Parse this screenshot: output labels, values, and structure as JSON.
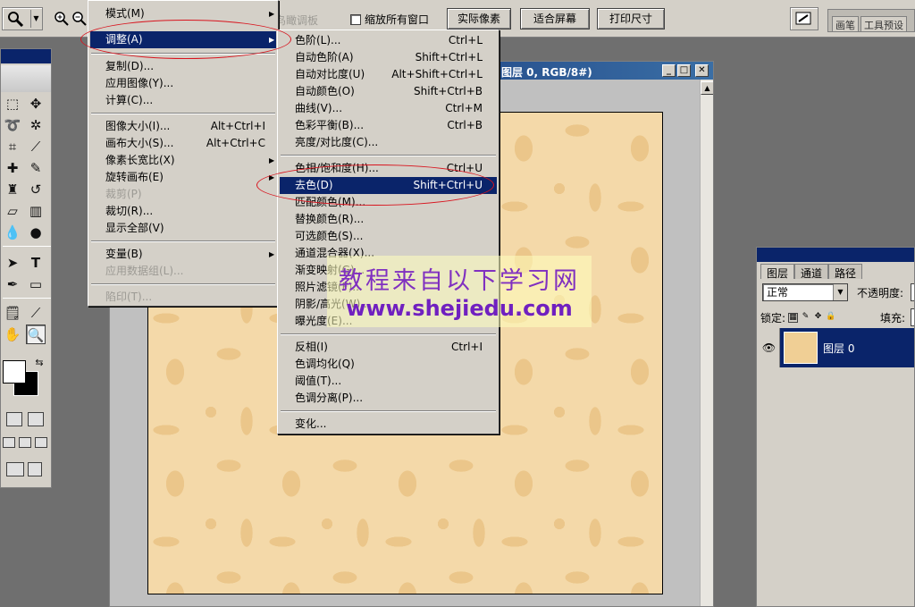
{
  "options_bar": {
    "grey_label": "鸟瞰调板",
    "resize_windows_label": "缩放所有窗口",
    "buttons": [
      "实际像素",
      "适合屏幕",
      "打印尺寸"
    ],
    "palette_well_tabs": [
      "画笔",
      "工具预设"
    ]
  },
  "document": {
    "title": "图层 0, RGB/8#)"
  },
  "image_menu": {
    "items": [
      {
        "label": "模式(M)",
        "shortcut": "",
        "submenu": true,
        "state": "normal"
      },
      {
        "label": "调整(A)",
        "shortcut": "",
        "submenu": true,
        "state": "selected"
      },
      {
        "label": "复制(D)...",
        "shortcut": "",
        "submenu": false,
        "state": "normal"
      },
      {
        "label": "应用图像(Y)...",
        "shortcut": "",
        "submenu": false,
        "state": "normal"
      },
      {
        "label": "计算(C)...",
        "shortcut": "",
        "submenu": false,
        "state": "normal"
      },
      {
        "label": "图像大小(I)...",
        "shortcut": "Alt+Ctrl+I",
        "submenu": false,
        "state": "normal"
      },
      {
        "label": "画布大小(S)...",
        "shortcut": "Alt+Ctrl+C",
        "submenu": false,
        "state": "normal"
      },
      {
        "label": "像素长宽比(X)",
        "shortcut": "",
        "submenu": true,
        "state": "normal"
      },
      {
        "label": "旋转画布(E)",
        "shortcut": "",
        "submenu": true,
        "state": "normal"
      },
      {
        "label": "裁剪(P)",
        "shortcut": "",
        "submenu": false,
        "state": "disabled"
      },
      {
        "label": "裁切(R)...",
        "shortcut": "",
        "submenu": false,
        "state": "normal"
      },
      {
        "label": "显示全部(V)",
        "shortcut": "",
        "submenu": false,
        "state": "normal"
      },
      {
        "label": "变量(B)",
        "shortcut": "",
        "submenu": true,
        "state": "normal"
      },
      {
        "label": "应用数据组(L)...",
        "shortcut": "",
        "submenu": false,
        "state": "disabled"
      },
      {
        "label": "陷印(T)...",
        "shortcut": "",
        "submenu": false,
        "state": "disabled"
      }
    ]
  },
  "adjust_menu": {
    "items": [
      {
        "label": "色阶(L)...",
        "shortcut": "Ctrl+L",
        "state": "normal"
      },
      {
        "label": "自动色阶(A)",
        "shortcut": "Shift+Ctrl+L",
        "state": "normal"
      },
      {
        "label": "自动对比度(U)",
        "shortcut": "Alt+Shift+Ctrl+L",
        "state": "normal"
      },
      {
        "label": "自动颜色(O)",
        "shortcut": "Shift+Ctrl+B",
        "state": "normal"
      },
      {
        "label": "曲线(V)...",
        "shortcut": "Ctrl+M",
        "state": "normal"
      },
      {
        "label": "色彩平衡(B)...",
        "shortcut": "Ctrl+B",
        "state": "normal"
      },
      {
        "label": "亮度/对比度(C)...",
        "shortcut": "",
        "state": "normal"
      },
      {
        "label": "色相/饱和度(H)...",
        "shortcut": "Ctrl+U",
        "state": "normal"
      },
      {
        "label": "去色(D)",
        "shortcut": "Shift+Ctrl+U",
        "state": "selected"
      },
      {
        "label": "匹配颜色(M)...",
        "shortcut": "",
        "state": "normal"
      },
      {
        "label": "替换颜色(R)...",
        "shortcut": "",
        "state": "normal"
      },
      {
        "label": "可选颜色(S)...",
        "shortcut": "",
        "state": "normal"
      },
      {
        "label": "通道混合器(X)...",
        "shortcut": "",
        "state": "normal"
      },
      {
        "label": "渐变映射(G)...",
        "shortcut": "",
        "state": "normal"
      },
      {
        "label": "照片滤镜(F)...",
        "shortcut": "",
        "state": "normal"
      },
      {
        "label": "阴影/高光(W)...",
        "shortcut": "",
        "state": "normal"
      },
      {
        "label": "曝光度(E)...",
        "shortcut": "",
        "state": "normal"
      },
      {
        "label": "反相(I)",
        "shortcut": "Ctrl+I",
        "state": "normal"
      },
      {
        "label": "色调均化(Q)",
        "shortcut": "",
        "state": "normal"
      },
      {
        "label": "阈值(T)...",
        "shortcut": "",
        "state": "normal"
      },
      {
        "label": "色调分离(P)...",
        "shortcut": "",
        "state": "normal"
      },
      {
        "label": "变化...",
        "shortcut": "",
        "state": "normal"
      }
    ]
  },
  "layers_panel": {
    "tabs": [
      "图层",
      "通道",
      "路径"
    ],
    "blend_mode": "正常",
    "opacity_label": "不透明度:",
    "lock_label": "锁定:",
    "fill_label": "填充:",
    "layer_name": "图层 0"
  },
  "watermark": {
    "line1": "教程来自以下学习网",
    "line2": "www.shejiedu.com"
  },
  "colors": {
    "selection": "#0a246a",
    "menu_bg": "#d4d0c8",
    "annotation_ring": "#d8141e",
    "canvas_base": "#f4d9a9",
    "canvas_pattern": "#ebc68a"
  }
}
